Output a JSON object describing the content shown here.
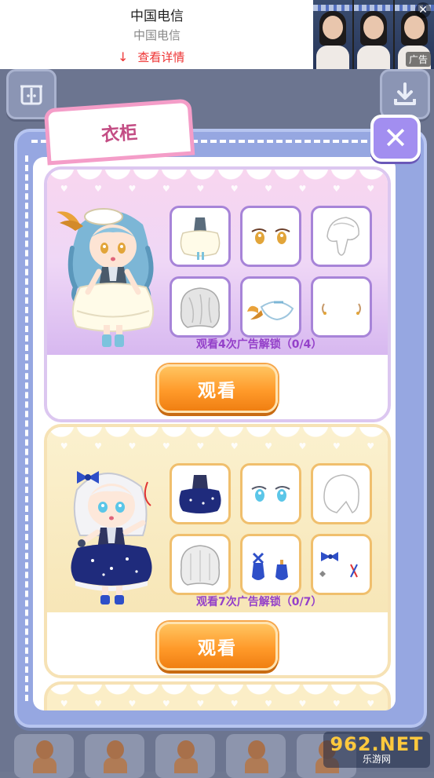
{
  "ad": {
    "title": "中国电信",
    "subtitle": "中国电信",
    "link_label": "查看详情",
    "tag_label": "广告",
    "close_glyph": "✕"
  },
  "wardrobe": {
    "title": "衣柜",
    "close_glyph": "✕"
  },
  "outfits": [
    {
      "theme": "pink",
      "unlock_text": "观看4次广告解锁（0/4）",
      "watch_label": "观看",
      "items": [
        "dress-icon",
        "eyes-icon",
        "hair-back-icon",
        "hair-front-icon",
        "headpiece-icon",
        "earrings-icon"
      ]
    },
    {
      "theme": "yellow",
      "unlock_text": "观看7次广告解锁（0/7）",
      "watch_label": "观看",
      "items": [
        "dress-icon",
        "eyes-icon",
        "hair-back-icon",
        "hair-front-icon",
        "shoes-icon",
        "hair-accessory-icon"
      ]
    }
  ],
  "watermark": {
    "brand": "962.NET",
    "sub": "乐游网"
  },
  "colors": {
    "pink_border": "#a784d8",
    "yellow_border": "#f0bf6d",
    "unlock_text": "#9440c9",
    "button_orange": "#ff9a2a",
    "close_purple": "#a28ef0",
    "tab_pink": "#f49dc8"
  }
}
